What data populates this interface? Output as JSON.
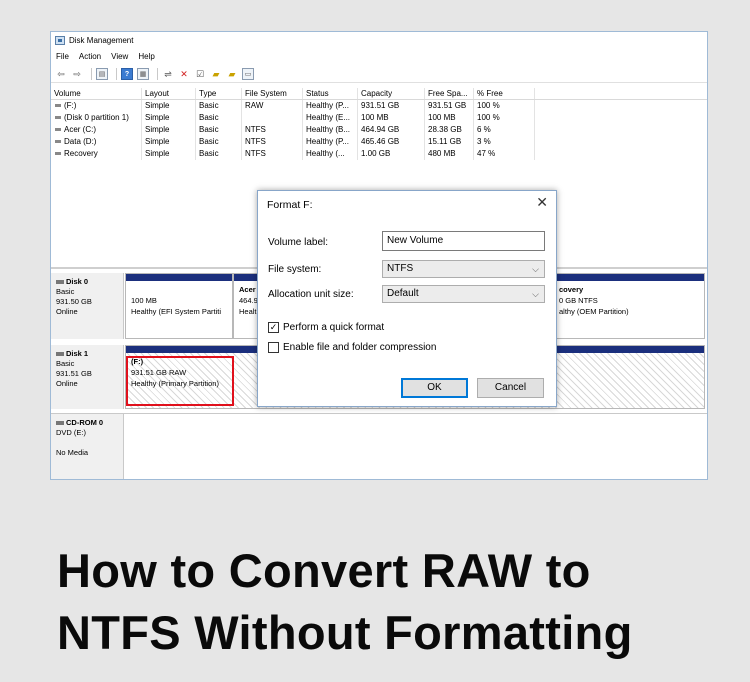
{
  "window": {
    "title": "Disk Management",
    "menu": [
      "File",
      "Action",
      "View",
      "Help"
    ]
  },
  "volume_table": {
    "columns": [
      "Volume",
      "Layout",
      "Type",
      "File System",
      "Status",
      "Capacity",
      "Free Spa...",
      "% Free"
    ],
    "rows": [
      [
        "(F:)",
        "Simple",
        "Basic",
        "RAW",
        "Healthy (P...",
        "931.51 GB",
        "931.51 GB",
        "100 %"
      ],
      [
        "(Disk 0 partition 1)",
        "Simple",
        "Basic",
        "",
        "Healthy (E...",
        "100 MB",
        "100 MB",
        "100 %"
      ],
      [
        "Acer (C:)",
        "Simple",
        "Basic",
        "NTFS",
        "Healthy (B...",
        "464.94 GB",
        "28.38 GB",
        "6 %"
      ],
      [
        "Data (D:)",
        "Simple",
        "Basic",
        "NTFS",
        "Healthy (P...",
        "465.46 GB",
        "15.11 GB",
        "3 %"
      ],
      [
        "Recovery",
        "Simple",
        "Basic",
        "NTFS",
        "Healthy (...",
        "1.00 GB",
        "480 MB",
        "47 %"
      ]
    ]
  },
  "disks": {
    "disk0": {
      "name": "Disk 0",
      "type": "Basic",
      "size": "931.50 GB",
      "state": "Online",
      "p1": {
        "line1": "100 MB",
        "line2": "Healthy (EFI System Partiti"
      },
      "p2": {
        "line0": "Acer",
        "line1": "464.9",
        "line2": "Healt"
      },
      "p3": {
        "line0": "covery",
        "line1": "0 GB NTFS",
        "line2": "althy (OEM Partition)"
      }
    },
    "disk1": {
      "name": "Disk 1",
      "type": "Basic",
      "size": "931.51 GB",
      "state": "Online",
      "p1": {
        "line0": "(F:)",
        "line1": "931.51 GB RAW",
        "line2": "Healthy (Primary Partition)"
      }
    },
    "cdrom0": {
      "name": "CD-ROM 0",
      "type": "DVD (E:)",
      "state": "No Media"
    }
  },
  "format_dialog": {
    "title": "Format F:",
    "volume_label_label": "Volume label:",
    "volume_label_value": "New Volume",
    "file_system_label": "File system:",
    "file_system_value": "NTFS",
    "alloc_label": "Allocation unit size:",
    "alloc_value": "Default",
    "quick_format_label": "Perform a quick format",
    "quick_format_checked": true,
    "compression_label": "Enable file and folder compression",
    "compression_checked": false,
    "ok_label": "OK",
    "cancel_label": "Cancel"
  },
  "headline": {
    "line1": "How to Convert RAW to",
    "line2": "NTFS Without Formatting"
  }
}
